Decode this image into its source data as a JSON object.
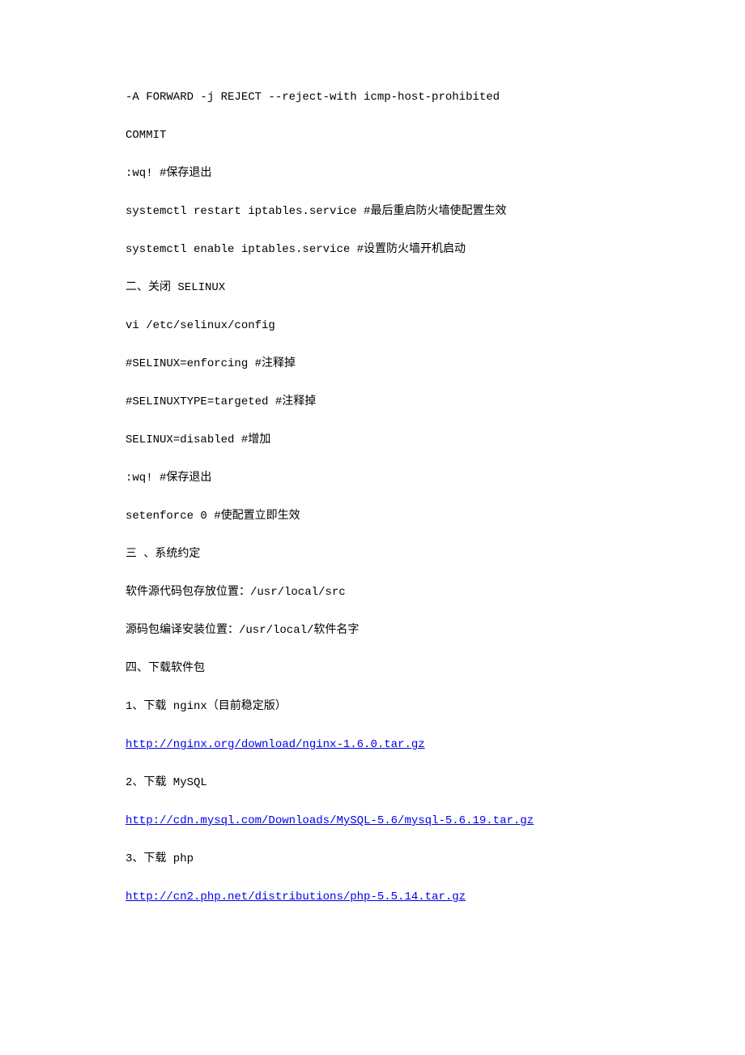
{
  "lines": [
    {
      "type": "text",
      "value": "-A FORWARD -j REJECT --reject-with icmp-host-prohibited"
    },
    {
      "type": "text",
      "value": "COMMIT"
    },
    {
      "type": "text",
      "value": ":wq! #保存退出"
    },
    {
      "type": "text",
      "value": "systemctl restart iptables.service #最后重启防火墙使配置生效"
    },
    {
      "type": "text",
      "value": "systemctl enable iptables.service #设置防火墙开机启动"
    },
    {
      "type": "text",
      "value": "二、关闭 SELINUX"
    },
    {
      "type": "text",
      "value": "vi /etc/selinux/config"
    },
    {
      "type": "text",
      "value": "#SELINUX=enforcing #注释掉"
    },
    {
      "type": "text",
      "value": "#SELINUXTYPE=targeted #注释掉"
    },
    {
      "type": "text",
      "value": "SELINUX=disabled #增加"
    },
    {
      "type": "text",
      "value": ":wq! #保存退出"
    },
    {
      "type": "text",
      "value": "setenforce 0 #使配置立即生效"
    },
    {
      "type": "text",
      "value": "三 、系统约定"
    },
    {
      "type": "text",
      "value": "软件源代码包存放位置：/usr/local/src"
    },
    {
      "type": "text",
      "value": "源码包编译安装位置：/usr/local/软件名字"
    },
    {
      "type": "text",
      "value": "四、下载软件包"
    },
    {
      "type": "text",
      "value": "1、下载 nginx（目前稳定版）"
    },
    {
      "type": "link",
      "value": "http://nginx.org/download/nginx-1.6.0.tar.gz"
    },
    {
      "type": "text",
      "value": "2、下载 MySQL"
    },
    {
      "type": "link",
      "value": "http://cdn.mysql.com/Downloads/MySQL-5.6/mysql-5.6.19.tar.gz"
    },
    {
      "type": "text",
      "value": "3、下载 php"
    },
    {
      "type": "link",
      "value": "http://cn2.php.net/distributions/php-5.5.14.tar.gz"
    }
  ]
}
